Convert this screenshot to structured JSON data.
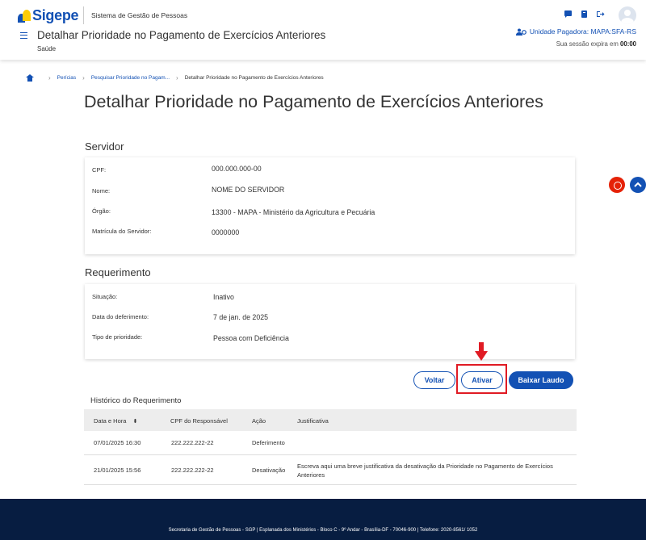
{
  "header": {
    "logo_text": "Sigepe",
    "system_name": "Sistema de Gestão de Pessoas",
    "page_heading": "Detalhar Prioridade no Pagamento de Exercícios Anteriores",
    "page_subheading": "Saúde",
    "unidade": "Unidade Pagadora: MAPA:SFA-RS",
    "session_prefix": "Sua sessão expira em",
    "session_time": "00:00",
    "icons": [
      "chat-icon",
      "book-icon",
      "logout-icon"
    ]
  },
  "breadcrumb": {
    "items": [
      "Perícias",
      "Pesquisar Prioridade no Pagam...",
      "Detalhar Prioridade no Pagamento de Exercícios Anteriores"
    ]
  },
  "title": "Detalhar Prioridade no Pagamento de Exercícios Anteriores",
  "servidor": {
    "title": "Servidor",
    "fields": [
      {
        "label": "CPF:",
        "value": "000.000.000-00"
      },
      {
        "label": "Nome:",
        "value": "NOME DO SERVIDOR"
      },
      {
        "label": "Órgão:",
        "value": "13300 - MAPA - Ministério da Agricultura e Pecuária"
      },
      {
        "label": "Matrícula do Servidor:",
        "value": "0000000"
      }
    ]
  },
  "requerimento": {
    "title": "Requerimento",
    "fields": [
      {
        "label": "Situação:",
        "value": "Inativo"
      },
      {
        "label": "Data do deferimento:",
        "value": "7 de jan. de 2025"
      },
      {
        "label": "Tipo de prioridade:",
        "value": "Pessoa com Deficiência"
      }
    ]
  },
  "actions": {
    "voltar": "Voltar",
    "ativar": "Ativar",
    "baixar": "Baixar Laudo"
  },
  "historico": {
    "title": "Histórico do Requerimento",
    "columns": [
      "Data e Hora",
      "CPF do Responsável",
      "Ação",
      "Justificativa"
    ],
    "rows": [
      {
        "data": "07/01/2025 16:30",
        "cpf": "222.222.222-22",
        "acao": "Deferimento",
        "justificativa": ""
      },
      {
        "data": "21/01/2025 15:56",
        "cpf": "222.222.222-22",
        "acao": "Desativação",
        "justificativa_l1": "Escreva aqui uma breve justificativa da desativação da Prioridade no Pagamento de Exercícios",
        "justificativa_l2": "Anteriores"
      }
    ]
  },
  "footer": {
    "text": "Secretaria de Gestão de Pessoas - SGP | Esplanada dos Ministérios - Bloco C - 9º Andar - Brasília-DF - 70046-900 | Telefone: 2020-8561/ 1052"
  },
  "colors": {
    "primary": "#1351b4",
    "highlight": "#e01b24",
    "footer_bg": "#071d41"
  }
}
